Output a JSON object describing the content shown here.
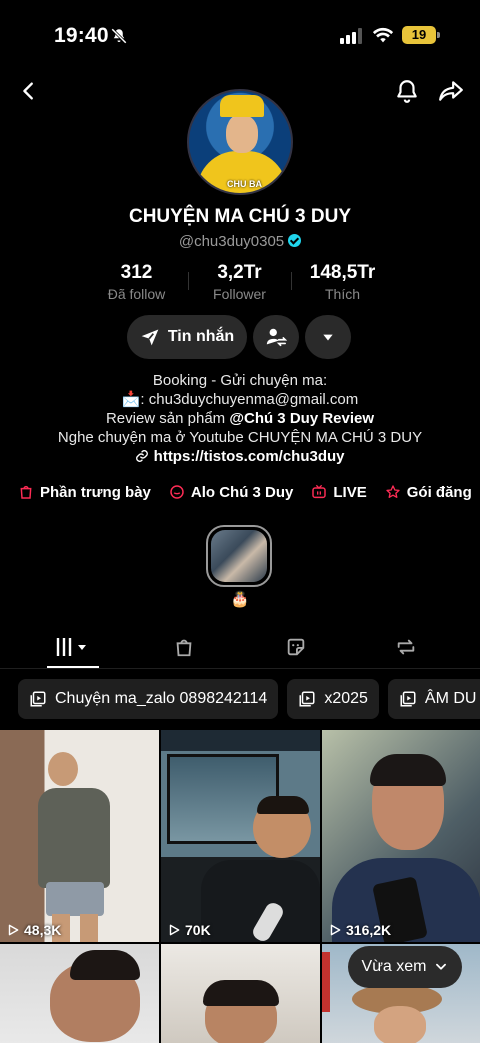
{
  "status_bar": {
    "time": "19:40",
    "battery": "19"
  },
  "profile": {
    "display_name": "CHUYỆN MA CHÚ 3 DUY",
    "handle": "@chu3duy0305",
    "avatar_caption": "CHU BA"
  },
  "stats": [
    {
      "value": "312",
      "label": "Đã follow"
    },
    {
      "value": "3,2Tr",
      "label": "Follower"
    },
    {
      "value": "148,5Tr",
      "label": "Thích"
    }
  ],
  "actions": {
    "message": "Tin nhắn"
  },
  "bio": {
    "line1": "Booking - Gửi chuyện ma:",
    "line2_emoji": "📩",
    "line2": ": chu3duychuyenma@gmail.com",
    "line3_prefix": "Review sản phẩm ",
    "line3_mention": "@Chú 3 Duy Review",
    "line4": "Nghe chuyện ma ở Youtube CHUYỆN MA CHÚ 3 DUY",
    "link": "https://tistos.com/chu3duy"
  },
  "shortcuts": [
    {
      "label": "Phần trưng bày",
      "icon": "bag-icon"
    },
    {
      "label": "Alo Chú 3 Duy",
      "icon": "chat-icon"
    },
    {
      "label": "LIVE",
      "icon": "tv-icon"
    },
    {
      "label": "Gói đăng",
      "icon": "star-icon"
    }
  ],
  "highlight": {
    "emoji": "🎂"
  },
  "playlists": [
    {
      "label": "Chuyện ma_zalo 0898242114"
    },
    {
      "label": "x2025"
    },
    {
      "label": "ÂM DU"
    }
  ],
  "videos": [
    {
      "views": "48,3K"
    },
    {
      "views": "70K"
    },
    {
      "views": "316,2K"
    }
  ],
  "floating": {
    "recent_label": "Vừa xem"
  },
  "colors": {
    "accent_red": "#fe2c55",
    "verified": "#20d5ec",
    "battery": "#e8c43a"
  }
}
